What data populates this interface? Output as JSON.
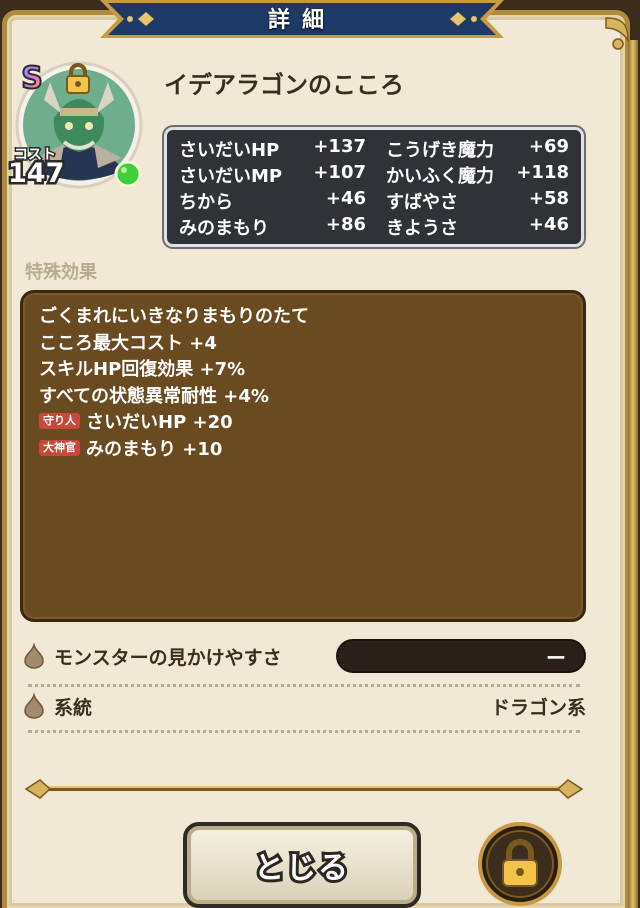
{
  "window": {
    "title": "詳細"
  },
  "portrait": {
    "rank": "S",
    "cost_label": "コスト",
    "cost": "147",
    "lock_icon": "lock-icon"
  },
  "heart": {
    "name": "イデアラゴンのこころ"
  },
  "stats": [
    [
      {
        "label": "さいだいHP",
        "value": "+137"
      },
      {
        "label": "こうげき魔力",
        "value": "+69"
      }
    ],
    [
      {
        "label": "さいだいMP",
        "value": "+107"
      },
      {
        "label": "かいふく魔力",
        "value": "+118"
      }
    ],
    [
      {
        "label": "ちから",
        "value": "+46"
      },
      {
        "label": "すばやさ",
        "value": "+58"
      }
    ],
    [
      {
        "label": "みのまもり",
        "value": "+86"
      },
      {
        "label": "きようさ",
        "value": "+46"
      }
    ]
  ],
  "effects": {
    "title": "特殊効果",
    "lines": [
      {
        "tag": "",
        "text": "ごくまれにいきなりまもりのたて"
      },
      {
        "tag": "",
        "text": "こころ最大コスト +4"
      },
      {
        "tag": "",
        "text": "スキルHP回復効果 +7%"
      },
      {
        "tag": "",
        "text": "すべての状態異常耐性 +4%"
      },
      {
        "tag": "守り人",
        "text": "さいだいHP +20"
      },
      {
        "tag": "大神官",
        "text": "みのまもり +10"
      }
    ]
  },
  "info": {
    "visibility_label": "モンスターの見かけやすさ",
    "visibility_value": "ー",
    "lineage_label": "系統",
    "lineage_value": "ドラゴン系"
  },
  "buttons": {
    "close_label": "とじる"
  },
  "colors": {
    "frame_gold": "#b08a3e",
    "panel_brown": "#6a4a20",
    "stats_bg": "#2f3236",
    "banner_navy": "#1d3a66"
  }
}
